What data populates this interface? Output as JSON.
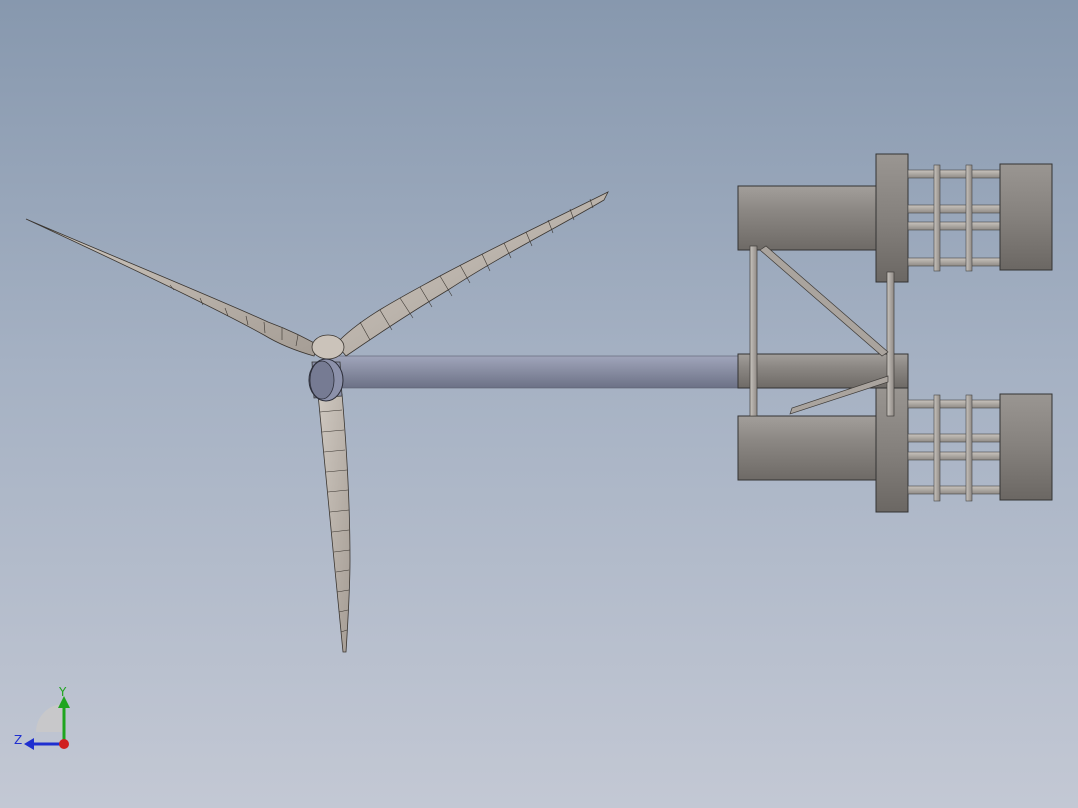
{
  "viewport": {
    "background_top": "#8798ae",
    "background_bottom": "#c3c8d4"
  },
  "model": {
    "name": "floating-wind-turbine",
    "blade_count": 3,
    "part_color": "#b8b0a8",
    "tower_color": "#8a8fa5"
  },
  "triad": {
    "y_label": "Y",
    "z_label": "Z",
    "y_color": "#1fa51f",
    "z_color": "#1f2fd0",
    "x_color": "#d01f1f"
  }
}
